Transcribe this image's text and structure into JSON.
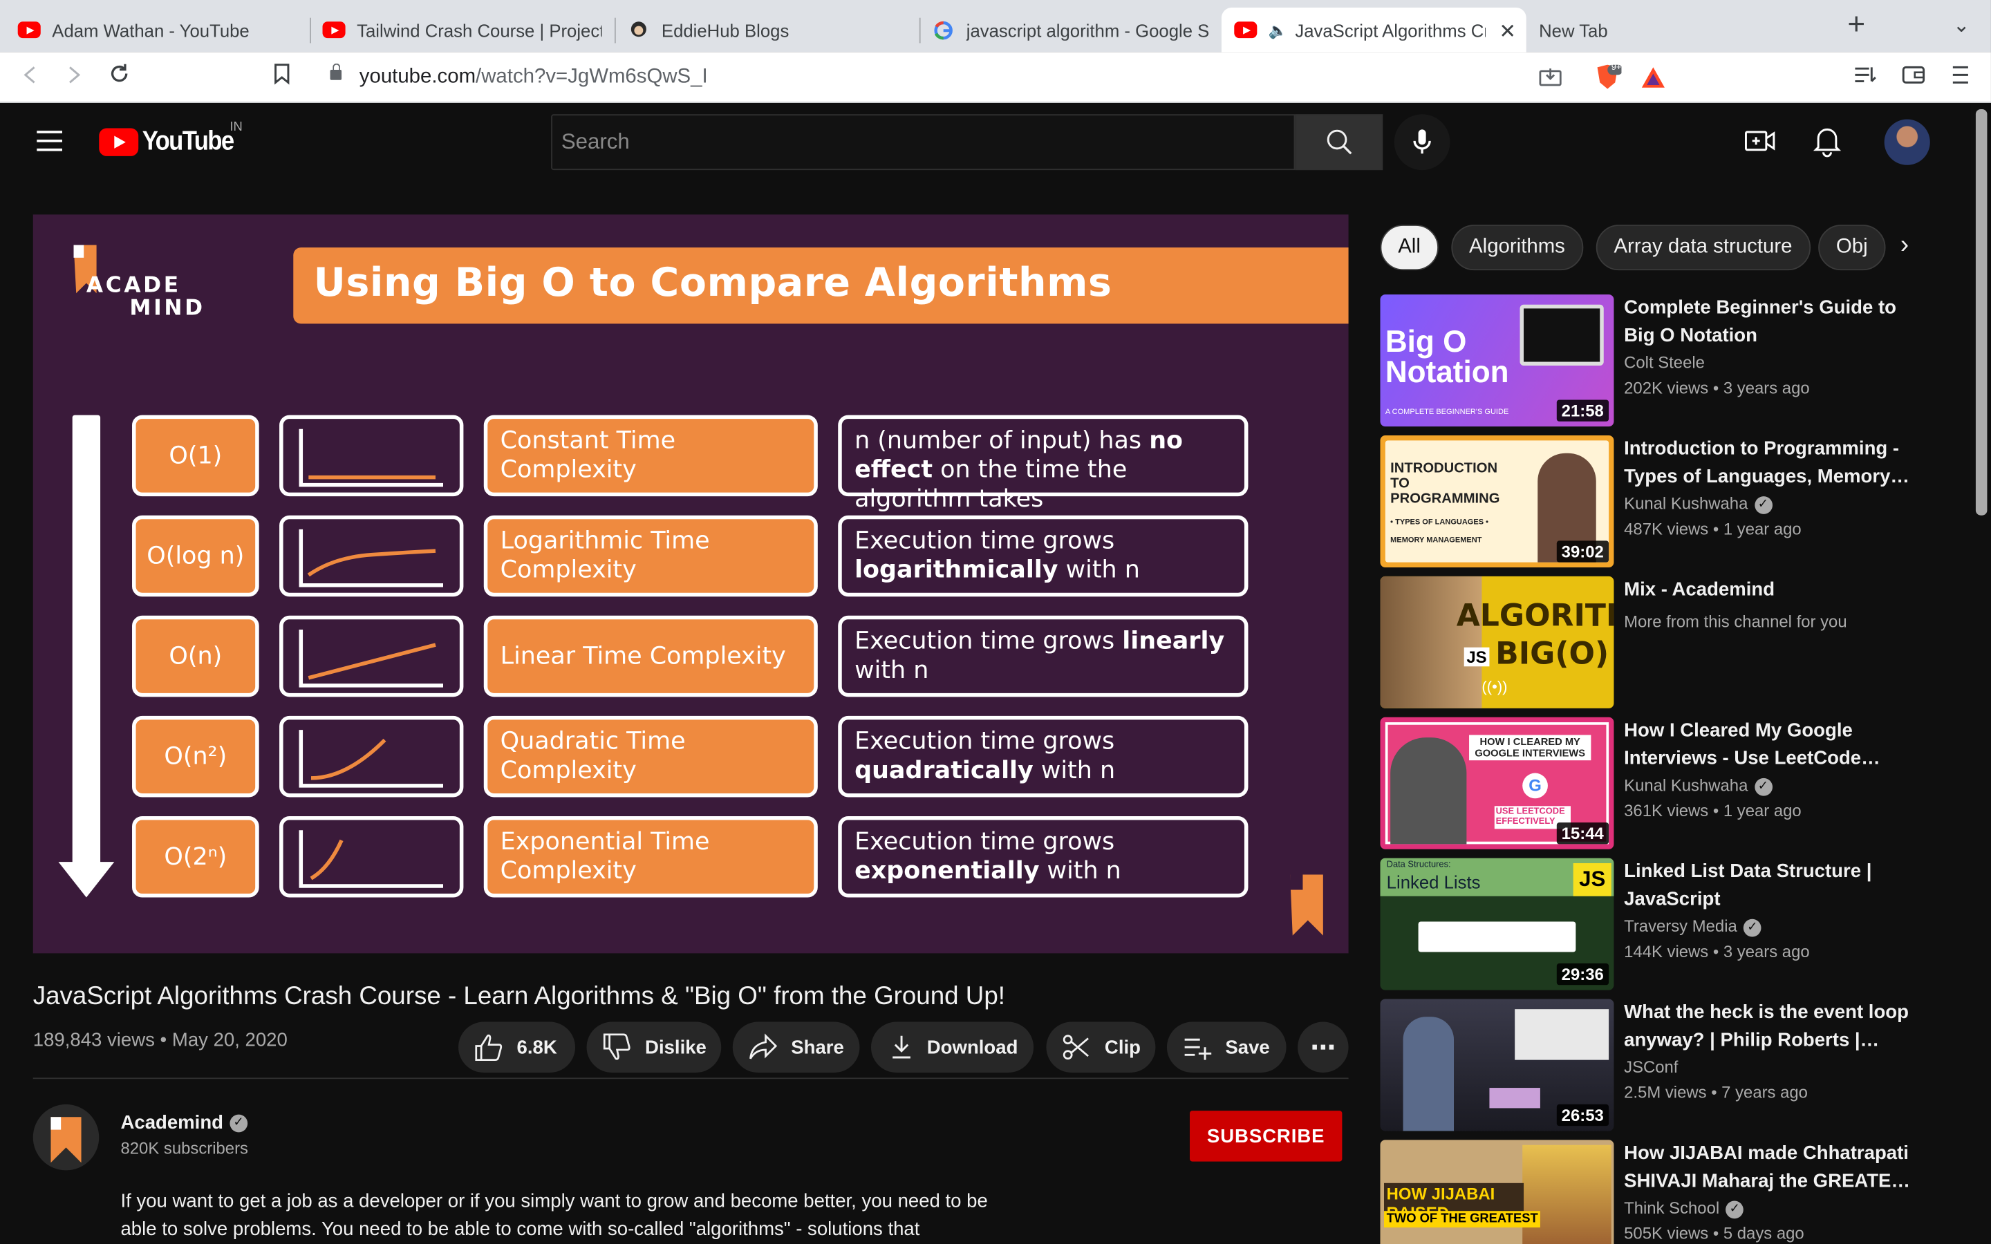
{
  "browser": {
    "tabs": [
      {
        "title": "Adam Wathan - YouTube",
        "icon": "youtube-icon"
      },
      {
        "title": "Tailwind Crash Course | Project Based Tutorial",
        "icon": "youtube-icon"
      },
      {
        "title": "EddieHub Blogs",
        "icon": "eddiehub-icon"
      },
      {
        "title": "javascript algorithm - Google Search",
        "icon": "google-icon"
      },
      {
        "title": "JavaScript Algorithms Crash Course",
        "icon": "youtube-icon"
      },
      {
        "title": "New Tab",
        "icon": ""
      }
    ],
    "active_tab": 4,
    "url_domain": "youtube.com",
    "url_path": "/watch?v=JgWm6sQwS_I",
    "brave_badge": "9+"
  },
  "masthead": {
    "logo_text": "YouTube",
    "country": "IN",
    "search_placeholder": "Search"
  },
  "player": {
    "slide_title": "Using Big O to Compare Algorithms",
    "logo_line1": "ACADE",
    "logo_line2": "MIND",
    "rows": [
      {
        "bigo": "O(1)",
        "name": "Constant Time Complexity",
        "desc_pre": "n (number of input) has ",
        "desc_bold": "no effect",
        "desc_post": " on the time the algorithm takes"
      },
      {
        "bigo": "O(log n)",
        "name": "Logarithmic Time Complexity",
        "desc_pre": "Execution time grows ",
        "desc_bold": "logarithmically",
        "desc_post": " with n"
      },
      {
        "bigo": "O(n)",
        "name": "Linear Time Complexity",
        "desc_pre": "Execution time grows ",
        "desc_bold": "linearly",
        "desc_post": " with n"
      },
      {
        "bigo": "O(n²)",
        "name": "Quadratic Time Complexity",
        "desc_pre": "Execution time grows ",
        "desc_bold": "quadratically",
        "desc_post": " with n"
      },
      {
        "bigo": "O(2ⁿ)",
        "name": "Exponential Time Complexity",
        "desc_pre": "Execution time grows ",
        "desc_bold": "exponentially",
        "desc_post": " with n"
      }
    ]
  },
  "video": {
    "title": "JavaScript Algorithms Crash Course - Learn Algorithms & \"Big O\" from the Ground Up!",
    "views": "189,843 views",
    "date": "May 20, 2020",
    "views_sep": " • ",
    "likes": "6.8K",
    "dislike_label": "Dislike",
    "share_label": "Share",
    "download_label": "Download",
    "clip_label": "Clip",
    "save_label": "Save",
    "more_label": "⋯"
  },
  "channel": {
    "name": "Academind",
    "subscribers": "820K subscribers",
    "subscribe_label": "SUBSCRIBE",
    "description": "If you want to get a job as a developer or if you simply want to grow and become better, you need to be able to solve problems. You need to be able to come with so-called \"algorithms\" - solutions that"
  },
  "sidebar": {
    "chips": [
      "All",
      "Algorithms",
      "Array data structure",
      "Obj"
    ],
    "recommendations": [
      {
        "title": "Complete Beginner's Guide to Big O Notation",
        "channel": "Colt Steele",
        "verified": false,
        "meta": "202K views • 3 years ago",
        "duration": "21:58",
        "thumb_text": "Big O Notation",
        "thumb_sub": "A COMPLETE BEGINNER'S GUIDE"
      },
      {
        "title": "Introduction to Programming - Types of Languages, Memory…",
        "channel": "Kunal Kushwaha",
        "verified": true,
        "meta": "487K views • 1 year ago",
        "duration": "39:02",
        "thumb_text": "INTRODUCTION TO PROGRAMMING",
        "thumb_sub": "• TYPES OF LANGUAGES • MEMORY MANAGEMENT"
      },
      {
        "title": "Mix - Academind",
        "channel": "More from this channel for you",
        "verified": false,
        "meta": "",
        "duration": "",
        "thumb_text": "ALGORITHMS BIG(O)",
        "thumb_sub": "JS"
      },
      {
        "title": "How I Cleared My Google Interviews - Use LeetCode…",
        "channel": "Kunal Kushwaha",
        "verified": true,
        "meta": "361K views • 1 year ago",
        "duration": "15:44",
        "thumb_text": "HOW I CLEARED MY GOOGLE INTERVIEWS",
        "thumb_sub": "USE LEETCODE EFFECTIVELY"
      },
      {
        "title": "Linked List Data Structure | JavaScript",
        "channel": "Traversy Media",
        "verified": true,
        "meta": "144K views • 3 years ago",
        "duration": "29:36",
        "thumb_text": "Linked Lists",
        "thumb_sub": "Data Structures:"
      },
      {
        "title": "What the heck is the event loop anyway? | Philip Roberts |…",
        "channel": "JSConf",
        "verified": false,
        "meta": "2.5M views • 7 years ago",
        "duration": "26:53",
        "thumb_text": "",
        "thumb_sub": ""
      },
      {
        "title": "How JIJABAI made Chhatrapati SHIVAJI Maharaj the GREATE…",
        "channel": "Think School",
        "verified": true,
        "meta": "505K views • 5 days ago",
        "duration": "",
        "thumb_text": "HOW JIJABAI RAISED",
        "thumb_sub": "TWO OF THE GREATEST"
      }
    ]
  }
}
